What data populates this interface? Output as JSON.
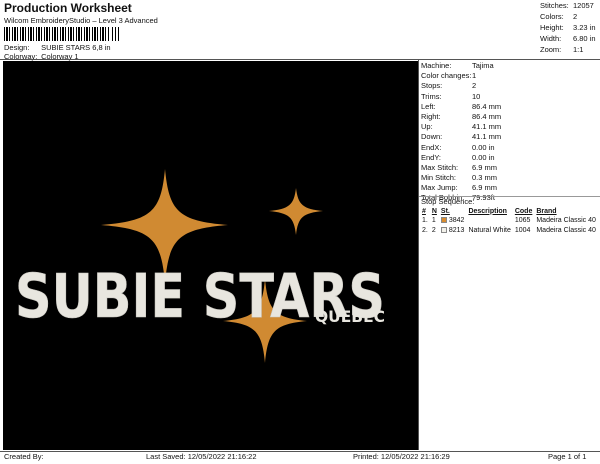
{
  "header": {
    "title": "Production Worksheet",
    "software": "Wilcom EmbroideryStudio – Level 3 Advanced",
    "design_label": "Design:",
    "design_value": "SUBIE STARS 6,8 in",
    "colorway_label": "Colorway:",
    "colorway_value": "Colorway 1"
  },
  "stats": [
    {
      "label": "Stitches:",
      "value": "12057"
    },
    {
      "label": "Colors:",
      "value": "2"
    },
    {
      "label": "Height:",
      "value": "3.23 in"
    },
    {
      "label": "Width:",
      "value": "6.80 in"
    },
    {
      "label": "Zoom:",
      "value": "1:1"
    }
  ],
  "machine": [
    {
      "label": "Machine:",
      "value": "Tajima"
    },
    {
      "label": "Color changes:",
      "value": "1"
    },
    {
      "label": "Stops:",
      "value": "2"
    },
    {
      "label": "Trims:",
      "value": "10"
    },
    {
      "label": "Left:",
      "value": "86.4 mm"
    },
    {
      "label": "Right:",
      "value": "86.4 mm"
    },
    {
      "label": "Up:",
      "value": "41.1 mm"
    },
    {
      "label": "Down:",
      "value": "41.1 mm"
    },
    {
      "label": "EndX:",
      "value": "0.00 in"
    },
    {
      "label": "EndY:",
      "value": "0.00 in"
    },
    {
      "label": "Max Stitch:",
      "value": "6.9 mm"
    },
    {
      "label": "Min Stitch:",
      "value": "0.3 mm"
    },
    {
      "label": "Max Jump:",
      "value": "6.9 mm"
    },
    {
      "label": "Total Bobbin:",
      "value": "79.93ft"
    }
  ],
  "stop_sequence": {
    "title": "Stop Sequence:",
    "columns": [
      "#",
      "N",
      "St.",
      "Description",
      "Code",
      "Brand"
    ],
    "rows": [
      {
        "num": "1.",
        "n": "1",
        "st": "3842",
        "desc": "",
        "code": "1065",
        "brand": "Madeira Classic 40",
        "color": "#d98c2e"
      },
      {
        "num": "2.",
        "n": "2",
        "st": "8213",
        "desc": "Natural White",
        "code": "1004",
        "brand": "Madeira Classic 40",
        "color": "#f2f1ea"
      }
    ]
  },
  "design": {
    "main_text": "SUBIE STARS",
    "sub_text": "QUEBEC",
    "star_color": "#d08a32",
    "text_color": "#e8e6df",
    "background": "#000000"
  },
  "footer": {
    "created": "Created By:",
    "last_saved": "Last Saved: 12/05/2022 21:16:22",
    "printed": "Printed: 12/05/2022 21:16:29",
    "page": "Page 1 of 1"
  }
}
